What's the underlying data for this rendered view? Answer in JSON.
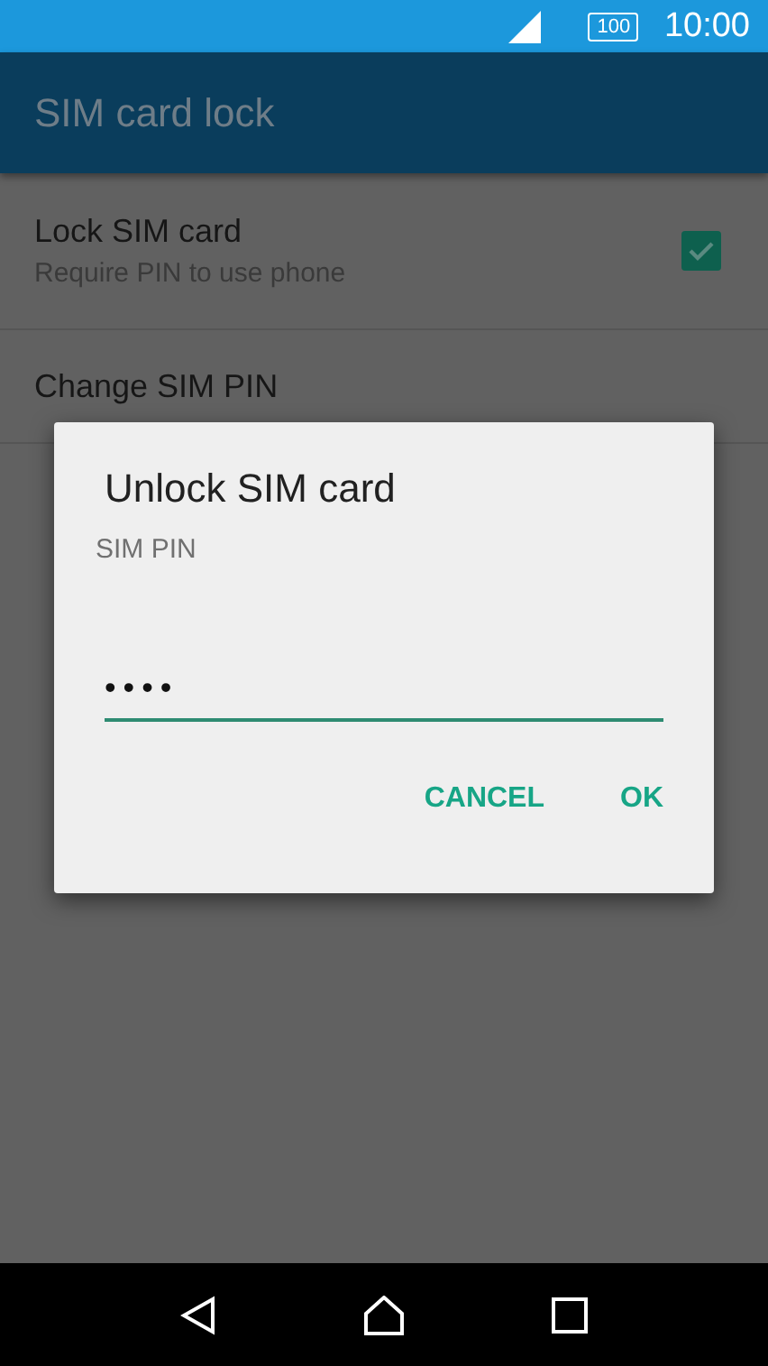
{
  "status_bar": {
    "battery": "100",
    "time": "10:00"
  },
  "app_bar": {
    "title": "SIM card lock"
  },
  "settings": [
    {
      "kind": "checkbox",
      "title": "Lock SIM card",
      "summary": "Require PIN to use phone",
      "checked": true
    },
    {
      "kind": "plain",
      "title": "Change SIM PIN"
    }
  ],
  "dialog": {
    "title": "Unlock SIM card",
    "message": "SIM PIN",
    "field": {
      "value": "••••"
    },
    "buttons": [
      "CANCEL",
      "OK"
    ]
  }
}
